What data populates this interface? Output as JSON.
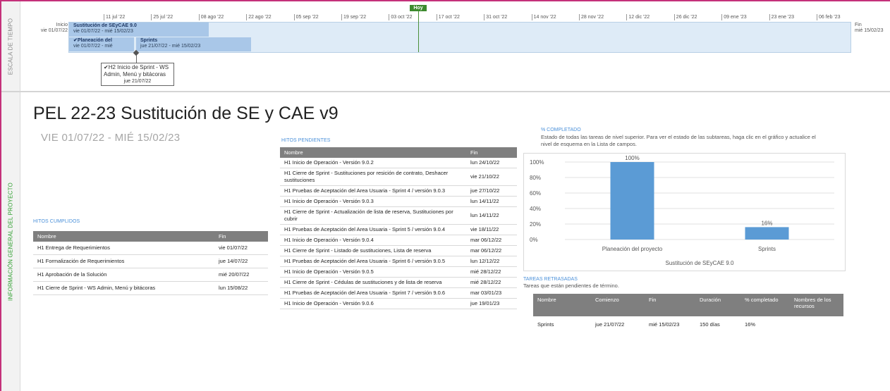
{
  "sidebar": {
    "timeline_label": "ESCALA DE TIEMPO",
    "overview_label": "INFORMACIÓN GENERAL DEL PROYECTO"
  },
  "timeline": {
    "today_label": "Hoy",
    "ticks": [
      "11 jul '22",
      "25 jul '22",
      "08 ago '22",
      "22 ago '22",
      "05 sep '22",
      "19 sep '22",
      "03 oct '22",
      "17 oct '22",
      "31 oct '22",
      "14 nov '22",
      "28 nov '22",
      "12 dic '22",
      "26 dic '22",
      "09 ene '23",
      "23 ene '23",
      "06 feb '23"
    ],
    "start_label": "Inicio",
    "start_date": "vie 01/07/22",
    "end_label": "Fin",
    "end_date": "mié 15/02/23",
    "bars": [
      {
        "name": "Sustitución de SEyCAE 9.0",
        "dates": "vie 01/07/22 - mié 15/02/23"
      },
      {
        "name": "✔Planeación del",
        "dates": "vie 01/07/22 - mié"
      },
      {
        "name": "Sprints",
        "dates": "jue 21/07/22 - mié 15/02/23"
      }
    ],
    "milestone": {
      "text": "H2 Inicio de Sprint - WS Admin, Menú y bitácoras",
      "date": "jue 21/07/22"
    }
  },
  "project": {
    "title": "PEL 22-23 Sustitución de SE y CAE v9",
    "dates": "VIE 01/07/22  - MIÉ 15/02/23"
  },
  "done": {
    "title": "HITOS CUMPLIDOS",
    "headers": [
      "Nombre",
      "Fin"
    ],
    "rows": [
      [
        "H1 Entrega de Requerimientos",
        "vie 01/07/22"
      ],
      [
        "H1 Formalización de Requerimientos",
        "jue 14/07/22"
      ],
      [
        "H1 Aprobación de la Solución",
        "mié 20/07/22"
      ],
      [
        "H1 Cierre de Sprint - WS Admin, Menú y bitácoras",
        "lun 15/08/22"
      ]
    ]
  },
  "pending": {
    "title": "HITOS PENDIENTES",
    "headers": [
      "Nombre",
      "Fin"
    ],
    "rows": [
      [
        "H1 Inicio de Operación - Versión 9.0.2",
        "lun 24/10/22"
      ],
      [
        "H1 Cierre de Sprint - Sustituciones por resición de contrato, Deshacer sustituciones",
        "vie 21/10/22"
      ],
      [
        "H1 Pruebas de Aceptación del Area Usuaria - Sprint 4 / versión 9.0.3",
        "jue 27/10/22"
      ],
      [
        "H1 Inicio de Operación - Versión 9.0.3",
        "lun 14/11/22"
      ],
      [
        "H1 Cierre de Sprint - Actualización de lista de reserva, Sustituciones por cubrir",
        "lun 14/11/22"
      ],
      [
        "H1 Pruebas de Aceptación del Area Usuaria - Sprint 5 / versión 9.0.4",
        "vie 18/11/22"
      ],
      [
        "H1 Inicio de Operación - Versión 9.0.4",
        "mar 06/12/22"
      ],
      [
        "H1 Cierre de Sprint - Listado de sustituciones, Lista de reserva",
        "mar 06/12/22"
      ],
      [
        "H1 Pruebas de Aceptación del Area Usuaria - Sprint 6 / versión 9.0.5",
        "lun 12/12/22"
      ],
      [
        "H1 Inicio de Operación - Versión 9.0.5",
        "mié 28/12/22"
      ],
      [
        "H1 Cierre de Sprint - Cédulas de sustituciones y de lista de reserva",
        "mié 28/12/22"
      ],
      [
        "H1 Pruebas de Aceptación del Area Usuaria - Sprint 7 / versión 9.0.6",
        "mar 03/01/23"
      ],
      [
        "H1 Inicio de Operación - Versión 9.0.6",
        "jue 19/01/23"
      ]
    ]
  },
  "percent": {
    "title": "% COMPLETADO",
    "description": "Estado de todas las tareas de nivel superior. Para ver el estado de las subtareas, haga clic en el gráfico y actualice el nivel de esquema en la Lista de campos."
  },
  "chart_data": {
    "type": "bar",
    "categories": [
      "Planeación del proyecto",
      "Sprints"
    ],
    "values": [
      100,
      16
    ],
    "data_labels": [
      "100%",
      "16%"
    ],
    "xlabel": "Sustitución de SEyCAE 9.0",
    "ylim": [
      0,
      100
    ],
    "yticks": [
      "0%",
      "20%",
      "40%",
      "60%",
      "80%",
      "100%"
    ],
    "grid": true,
    "bar_color": "#5b9bd5"
  },
  "late": {
    "title": "TAREAS RETRASADAS",
    "description": "Tareas que están pendientes de término.",
    "headers": [
      "Nombre",
      "Comienzo",
      "Fin",
      "Duración",
      "% completado",
      "Nombres de los recursos"
    ],
    "rows": [
      [
        "Sprints",
        "jue 21/07/22",
        "mié 15/02/23",
        "150 días",
        "16%",
        ""
      ]
    ]
  }
}
